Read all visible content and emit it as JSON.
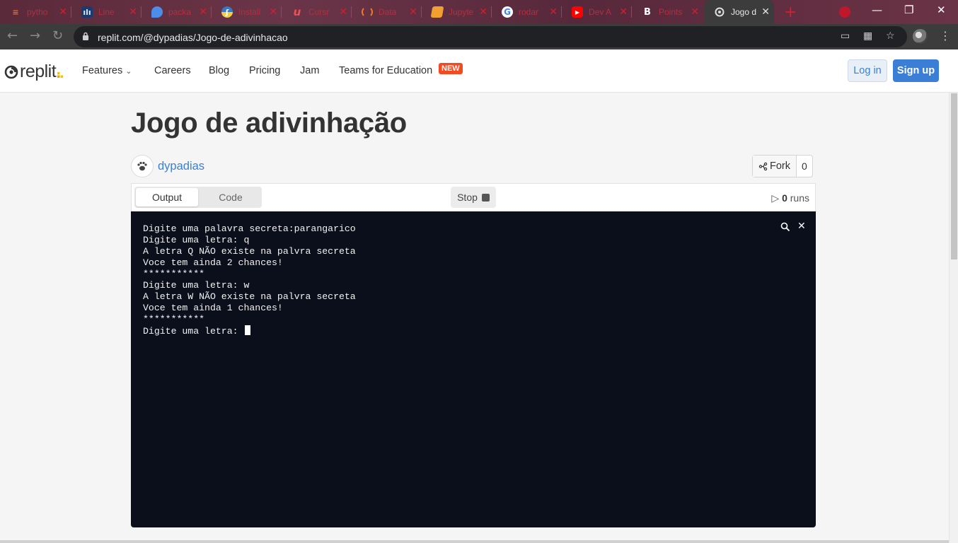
{
  "browser": {
    "tabs": [
      {
        "label": "pytho",
        "icon": "stackoverflow-icon"
      },
      {
        "label": "Line",
        "icon": "chart-icon"
      },
      {
        "label": "packa",
        "icon": "chat-icon"
      },
      {
        "label": "Install",
        "icon": "python-icon"
      },
      {
        "label": "Cursr",
        "icon": "udemy-icon"
      },
      {
        "label": "Data",
        "icon": "jupyter-icon"
      },
      {
        "label": "Jupyte",
        "icon": "book-icon"
      },
      {
        "label": "rodar",
        "icon": "google-icon"
      },
      {
        "label": "Dev A",
        "icon": "youtube-icon"
      },
      {
        "label": "Points",
        "icon": "bootstrap-icon"
      },
      {
        "label": "Jogo d",
        "icon": "replit-icon",
        "active": true
      }
    ],
    "url": "replit.com/@dypadias/Jogo-de-adivinhacao"
  },
  "site": {
    "logo": "replit",
    "nav": {
      "features": "Features",
      "careers": "Careers",
      "blog": "Blog",
      "pricing": "Pricing",
      "jam": "Jam",
      "teams": "Teams for Education",
      "new_badge": "NEW"
    },
    "login": "Log in",
    "signup": "Sign up"
  },
  "repl": {
    "title": "Jogo de adivinhação",
    "author": "dypadias",
    "fork_label": "Fork",
    "fork_count": "0",
    "tab_output": "Output",
    "tab_code": "Code",
    "stop_label": "Stop",
    "runs_count": "0",
    "runs_label": "runs"
  },
  "console": {
    "lines": [
      "Digite uma palavra secreta:parangarico",
      "Digite uma letra: q",
      "A letra Q NÃO existe na palvra secreta",
      "Voce tem ainda 2 chances!",
      "***********",
      "Digite uma letra: w",
      "A letra W NÃO existe na palvra secreta",
      "Voce tem ainda 1 chances!",
      "***********",
      "Digite uma letra: "
    ]
  },
  "colors": {
    "accent": "#3a7fd5",
    "console_bg": "#0b0f1c",
    "new_badge": "#f24b23"
  }
}
